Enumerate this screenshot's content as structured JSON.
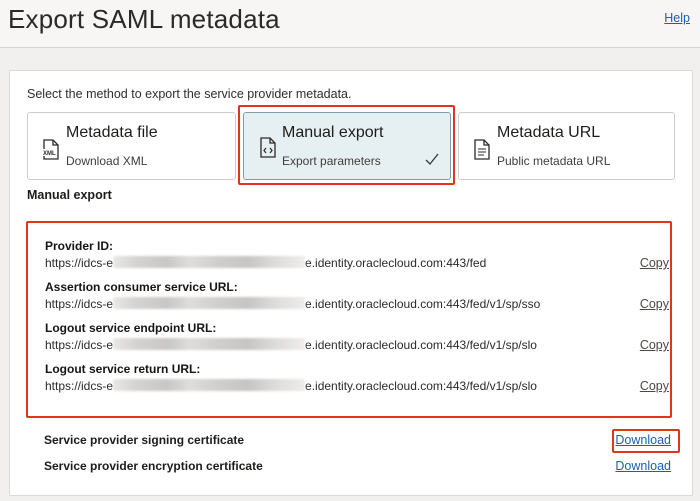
{
  "header": {
    "title": "Export SAML metadata",
    "help_label": "Help"
  },
  "instruction": "Select the method to export the service provider metadata.",
  "methods": [
    {
      "title": "Metadata file",
      "subtitle": "Download XML",
      "icon": "xml-file-icon",
      "selected": false
    },
    {
      "title": "Manual export",
      "subtitle": "Export parameters",
      "icon": "code-file-icon",
      "selected": true
    },
    {
      "title": "Metadata URL",
      "subtitle": "Public metadata URL",
      "icon": "document-url-icon",
      "selected": false
    }
  ],
  "section_label": "Manual export",
  "fields": [
    {
      "label": "Provider ID:",
      "value_prefix": "https://idcs-e",
      "value_suffix": "e.identity.oraclecloud.com:443/fed",
      "copy_label": "Copy"
    },
    {
      "label": "Assertion consumer service URL:",
      "value_prefix": "https://idcs-e",
      "value_suffix": "e.identity.oraclecloud.com:443/fed/v1/sp/sso",
      "copy_label": "Copy"
    },
    {
      "label": "Logout service endpoint URL:",
      "value_prefix": "https://idcs-e",
      "value_suffix": "e.identity.oraclecloud.com:443/fed/v1/sp/slo",
      "copy_label": "Copy"
    },
    {
      "label": "Logout service return URL:",
      "value_prefix": "https://idcs-e",
      "value_suffix": "e.identity.oraclecloud.com:443/fed/v1/sp/slo",
      "copy_label": "Copy"
    }
  ],
  "certificates": [
    {
      "label": "Service provider signing certificate",
      "action_label": "Download"
    },
    {
      "label": "Service provider encryption certificate",
      "action_label": "Download"
    }
  ],
  "colors": {
    "highlight": "#e0341c",
    "link": "#1a5fb4",
    "selected_card": "#e6f0f3"
  }
}
